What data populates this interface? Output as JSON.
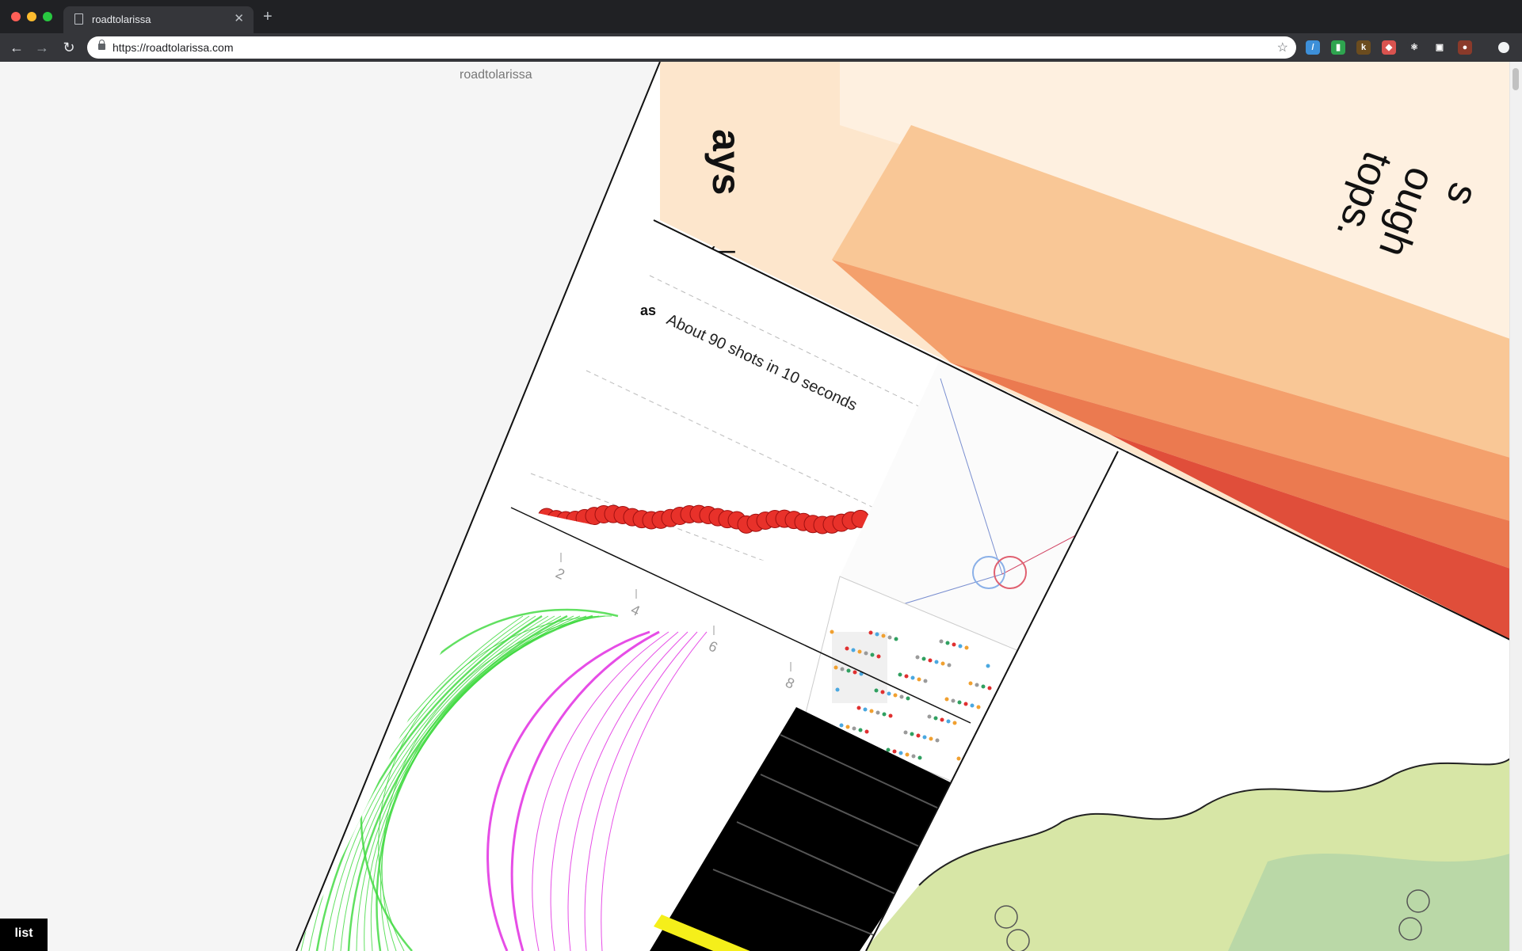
{
  "browser": {
    "tab_title": "roadtolarissa",
    "url": "https://roadtolarissa.com"
  },
  "extensions": [
    {
      "name": "extension-blue-icon",
      "color": "#3d8fd8",
      "glyph": "/"
    },
    {
      "name": "extension-green-icon",
      "color": "#2ea44f",
      "glyph": "▮"
    },
    {
      "name": "extension-k-icon",
      "color": "#6b4c1e",
      "glyph": "k"
    },
    {
      "name": "extension-shield-icon",
      "color": "#d9534f",
      "glyph": "◆"
    },
    {
      "name": "extension-react-icon",
      "color": "#35363a",
      "glyph": "⚛"
    },
    {
      "name": "extension-pip-icon",
      "color": "#35363a",
      "glyph": "▣"
    },
    {
      "name": "profile-avatar-icon",
      "color": "#8a3a2a",
      "glyph": "●"
    }
  ],
  "page": {
    "site_name": "roadtolarissa",
    "list_label": "list",
    "fragments": {
      "arrow_word": "ays",
      "orange_text_1": "tops.",
      "orange_text_2": "ough",
      "orange_text_3": "s",
      "partial_title": "as",
      "shots_caption": "About 90 shots in 10 seconds",
      "axis_ticks": [
        "2",
        "4",
        "6",
        "8"
      ]
    }
  }
}
